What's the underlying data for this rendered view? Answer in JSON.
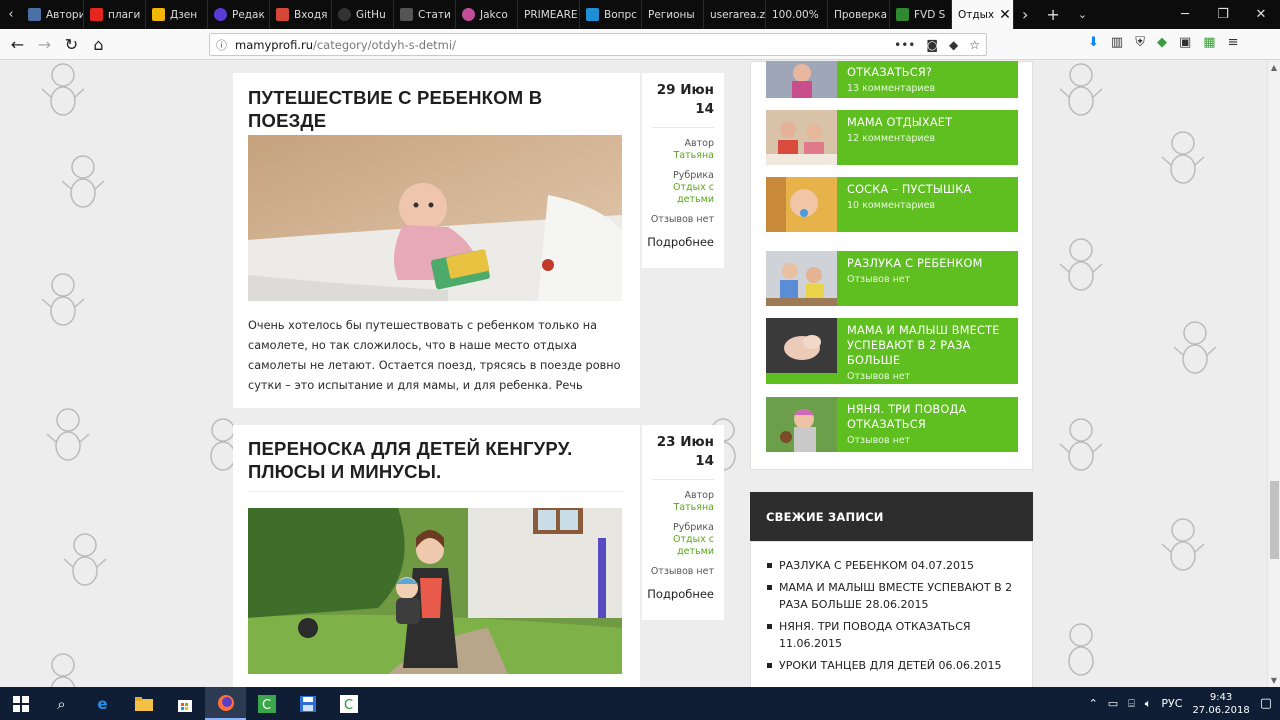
{
  "tabs": [
    {
      "label": "Авториза",
      "color": "#4a6fa5"
    },
    {
      "label": "плаги",
      "color": "#e52620"
    },
    {
      "label": "Дзен",
      "color": "#f2b705"
    },
    {
      "label": "Редак",
      "color": "#5b3bd6"
    },
    {
      "label": "Входя",
      "color": "#d44638"
    },
    {
      "label": "GitHu",
      "color": "#333333"
    },
    {
      "label": "Стати",
      "color": "#555555"
    },
    {
      "label": "Jakco",
      "color": "#c44d9a"
    },
    {
      "label": "PRIMEARE",
      "color": "#0c0c0d"
    },
    {
      "label": "Вопрс",
      "color": "#1f8fd6"
    },
    {
      "label": "Регионы",
      "color": "#0c0c0d"
    },
    {
      "label": "userarea.z",
      "color": "#0c0c0d"
    },
    {
      "label": "100.00%",
      "color": "#0c0c0d"
    },
    {
      "label": "Проверка",
      "color": "#0c0c0d"
    },
    {
      "label": "FVD S",
      "color": "#2f8a2f"
    }
  ],
  "active_tab": {
    "label": "Отдых",
    "close": "✕"
  },
  "url": {
    "host": "mamyprofi.ru",
    "path": "/category/otdyh-s-detmi/"
  },
  "posts": [
    {
      "title": "ПУТЕШЕСТВИЕ С РЕБЕНКОМ В ПОЕЗДЕ",
      "date": "29 Июн",
      "year": "14",
      "author_label": "Автор",
      "author": "Татьяна",
      "category_label": "Рубрика",
      "category": "Отдых с детьми",
      "reviews": "Отзывов нет",
      "more": "Подробнее",
      "excerpt": "Очень хотелось бы путешествовать с ребенком только на самолете, но так сложилось, что в наше место отдыха самолеты не летают. Остается поезд, трясясь в поезде ровно сутки – это испытание и для мамы, и для ребенка. Речь"
    },
    {
      "title": "ПЕРЕНОСКА ДЛЯ ДЕТЕЙ КЕНГУРУ. ПЛЮСЫ И МИНУСЫ.",
      "date": "23 Июн",
      "year": "14",
      "author_label": "Автор",
      "author": "Татьяна",
      "category_label": "Рубрика",
      "category": "Отдых с детьми",
      "reviews": "Отзывов нет",
      "more": "Подробнее"
    }
  ],
  "popular": [
    {
      "title": "ОТКАЗАТЬСЯ?",
      "count": "13 комментариев"
    },
    {
      "title": "МАМА ОТДЫХАЕТ",
      "count": "12 комментариев"
    },
    {
      "title": "СОСКА – ПУСТЫШКА",
      "count": "10 комментариев"
    },
    {
      "title": "РАЗЛУКА С РЕБЕНКОМ",
      "count": "Отзывов нет"
    },
    {
      "title": "МАМА И МАЛЫШ ВМЕСТЕ УСПЕВАЮТ В 2 РАЗА БОЛЬШЕ",
      "count": "Отзывов нет"
    },
    {
      "title": "НЯНЯ. ТРИ ПОВОДА ОТКАЗАТЬСЯ",
      "count": "Отзывов нет"
    }
  ],
  "recent": {
    "heading": "СВЕЖИЕ ЗАПИСИ",
    "items": [
      "РАЗЛУКА С РЕБЕНКОМ 04.07.2015",
      "МАМА И МАЛЫШ ВМЕСТЕ УСПЕВАЮТ В 2 РАЗА БОЛЬШЕ 28.06.2015",
      "НЯНЯ. ТРИ ПОВОДА ОТКАЗАТЬСЯ 11.06.2015",
      "УРОКИ ТАНЦЕВ ДЛЯ ДЕТЕЙ 06.06.2015"
    ]
  },
  "tray": {
    "lang": "РУС",
    "time": "9:43",
    "date": "27.06.2018"
  }
}
